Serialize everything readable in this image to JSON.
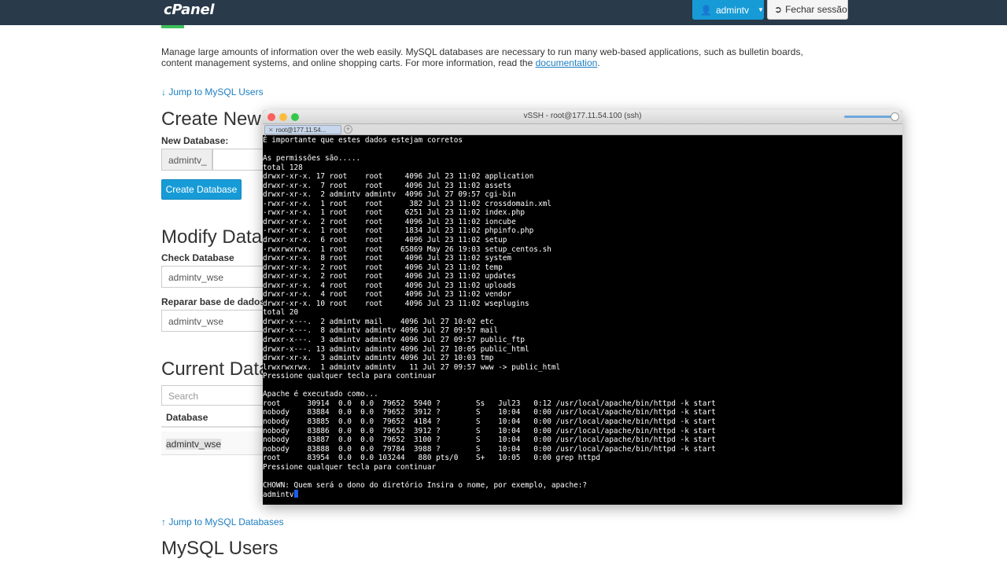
{
  "header": {
    "logo": "cPanel",
    "user_label": "admintv",
    "logout_label": "Fechar sessão"
  },
  "intro": {
    "text": "Manage large amounts of information over the web easily. MySQL databases are necessary to run many web-based applications, such as bulletin boards, content management systems, and online shopping carts. For more information, read the ",
    "link": "documentation",
    "end": "."
  },
  "links": {
    "jump_users": "↓ Jump to MySQL Users",
    "jump_databases": "↑ Jump to MySQL Databases"
  },
  "create": {
    "heading": "Create New",
    "label": "New Database:",
    "prefix": "admintv_",
    "button": "Create Database"
  },
  "modify": {
    "heading": "Modify Data",
    "check_label": "Check Database",
    "check_value": "admintv_wse",
    "repair_label": "Reparar base de dados",
    "repair_value": "admintv_wse"
  },
  "current": {
    "heading": "Current Data",
    "search_placeholder": "Search",
    "column": "Database",
    "rows": [
      "admintv_wse"
    ]
  },
  "mysql_users": {
    "heading": "MySQL Users"
  },
  "terminal": {
    "window_title": "vSSH - root@177.11.54.100 (ssh)",
    "tab_label": "root@177.11.54...",
    "lines": [
      "É importante que estes dados estejam corretos",
      "",
      "As permissões são.....",
      "total 128",
      "drwxr-xr-x. 17 root    root     4096 Jul 23 11:02 application",
      "drwxr-xr-x.  7 root    root     4096 Jul 23 11:02 assets",
      "drwxr-xr-x.  2 admintv admintv  4096 Jul 27 09:57 cgi-bin",
      "-rwxr-xr-x.  1 root    root      382 Jul 23 11:02 crossdomain.xml",
      "-rwxr-xr-x.  1 root    root     6251 Jul 23 11:02 index.php",
      "drwxr-xr-x.  2 root    root     4096 Jul 23 11:02 ioncube",
      "-rwxr-xr-x.  1 root    root     1834 Jul 23 11:02 phpinfo.php",
      "drwxr-xr-x.  6 root    root     4096 Jul 23 11:02 setup",
      "-rwxrwxrwx.  1 root    root    65869 May 26 19:03 setup_centos.sh",
      "drwxr-xr-x.  8 root    root     4096 Jul 23 11:02 system",
      "drwxr-xr-x.  2 root    root     4096 Jul 23 11:02 temp",
      "drwxr-xr-x.  2 root    root     4096 Jul 23 11:02 updates",
      "drwxr-xr-x.  4 root    root     4096 Jul 23 11:02 uploads",
      "drwxr-xr-x.  4 root    root     4096 Jul 23 11:02 vendor",
      "drwxr-xr-x. 10 root    root     4096 Jul 23 11:02 wseplugins",
      "total 20",
      "drwxr-x---.  2 admintv mail    4096 Jul 27 10:02 etc",
      "drwxr-x---.  8 admintv admintv 4096 Jul 27 09:57 mail",
      "drwxr-x---.  3 admintv admintv 4096 Jul 27 09:57 public_ftp",
      "drwxr-x---. 13 admintv admintv 4096 Jul 27 10:05 public_html",
      "drwxr-xr-x.  3 admintv admintv 4096 Jul 27 10:03 tmp",
      "lrwxrwxrwx.  1 admintv admintv   11 Jul 27 09:57 www -> public_html",
      "Pressione qualquer tecla para continuar",
      "",
      "Apache é executado como...",
      "root      30914  0.0  0.0  79652  5940 ?        Ss   Jul23   0:12 /usr/local/apache/bin/httpd -k start",
      "nobody    83884  0.0  0.0  79652  3912 ?        S    10:04   0:00 /usr/local/apache/bin/httpd -k start",
      "nobody    83885  0.0  0.0  79652  4184 ?        S    10:04   0:00 /usr/local/apache/bin/httpd -k start",
      "nobody    83886  0.0  0.0  79652  3912 ?        S    10:04   0:00 /usr/local/apache/bin/httpd -k start",
      "nobody    83887  0.0  0.0  79652  3100 ?        S    10:04   0:00 /usr/local/apache/bin/httpd -k start",
      "nobody    83888  0.0  0.0  79784  3988 ?        S    10:04   0:00 /usr/local/apache/bin/httpd -k start",
      "root      83954  0.0  0.0 103244   880 pts/0    S+   10:05   0:00 grep httpd",
      "Pressione qualquer tecla para continuar",
      "",
      "CHOWN: Quem será o dono do diretório Insira o nome, por exemplo, apache:?"
    ],
    "input_line": "admintv"
  },
  "colors": {
    "navbar": "#293a4a",
    "primary": "#179bd7",
    "link": "#1d7ec1",
    "accent": "#3bbf5a",
    "cursor": "#1c5de8"
  }
}
